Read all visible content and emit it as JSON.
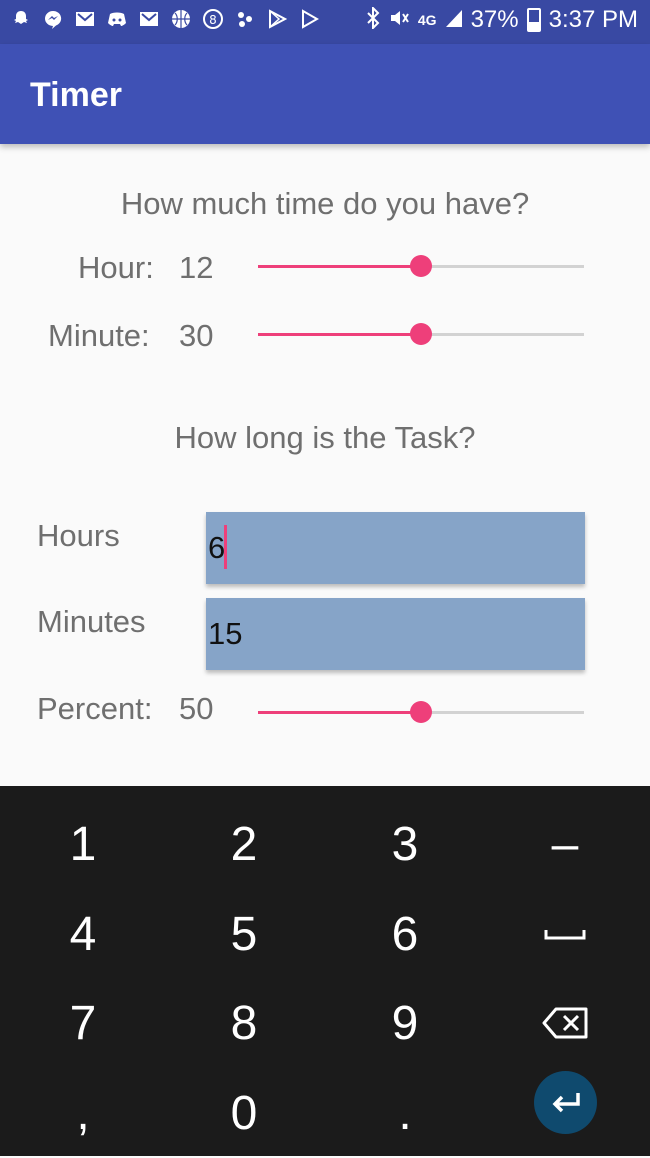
{
  "status_bar": {
    "left_icons": [
      "snapchat-icon",
      "messenger-icon",
      "gmail-icon",
      "discord-icon",
      "gmail-icon",
      "basketball-icon",
      "8ball-icon",
      "notification-icon",
      "play-store-icon",
      "play-icon"
    ],
    "network": "4G",
    "battery": "37%",
    "time": "3:37 PM"
  },
  "app_bar": {
    "title": "Timer"
  },
  "time_section": {
    "title": "How much time do you have?",
    "hour": {
      "label": "Hour:",
      "value": "12",
      "fraction": 0.5
    },
    "minute": {
      "label": "Minute:",
      "value": "30",
      "fraction": 0.5
    }
  },
  "task_section": {
    "title": "How long is the Task?",
    "hours": {
      "label": "Hours",
      "value": "6"
    },
    "minutes": {
      "label": "Minutes",
      "value": "15"
    },
    "percent": {
      "label": "Percent:",
      "value": "50",
      "fraction": 0.5
    }
  },
  "keyboard": {
    "keys": [
      "1",
      "2",
      "3",
      "–",
      "4",
      "5",
      "6",
      "␣",
      "7",
      "8",
      "9",
      "⌫",
      ",",
      "0",
      ".",
      "↵"
    ]
  },
  "colors": {
    "app_bar": "#3f51b5",
    "status_bar": "#3949a3",
    "accent": "#ee3f7a",
    "field_bg": "#86a4c8",
    "keyboard_bg": "#1b1b1b",
    "enter_bg": "#0f4a6e"
  }
}
